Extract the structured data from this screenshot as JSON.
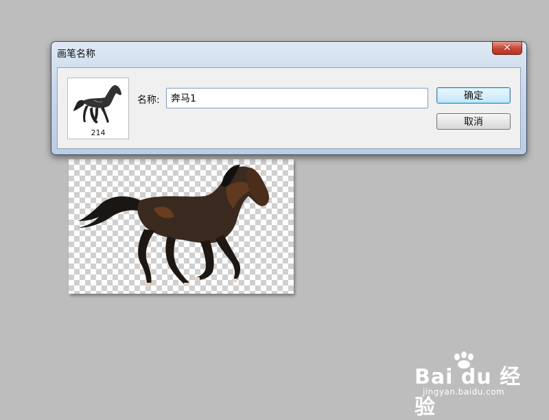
{
  "dialog": {
    "title": "画笔名称",
    "close_glyph": "✕",
    "preview_size": "214",
    "name_label": "名称:",
    "name_value": "奔马1",
    "ok_label": "确定",
    "cancel_label": "取消"
  },
  "icons": {
    "close": "close-icon",
    "preview": "horse-brush-preview",
    "document": "horse-image"
  },
  "colors": {
    "workspace": "#bdbdbd",
    "close_button": "#c9483a",
    "ok_border": "#3c7fb1"
  }
}
